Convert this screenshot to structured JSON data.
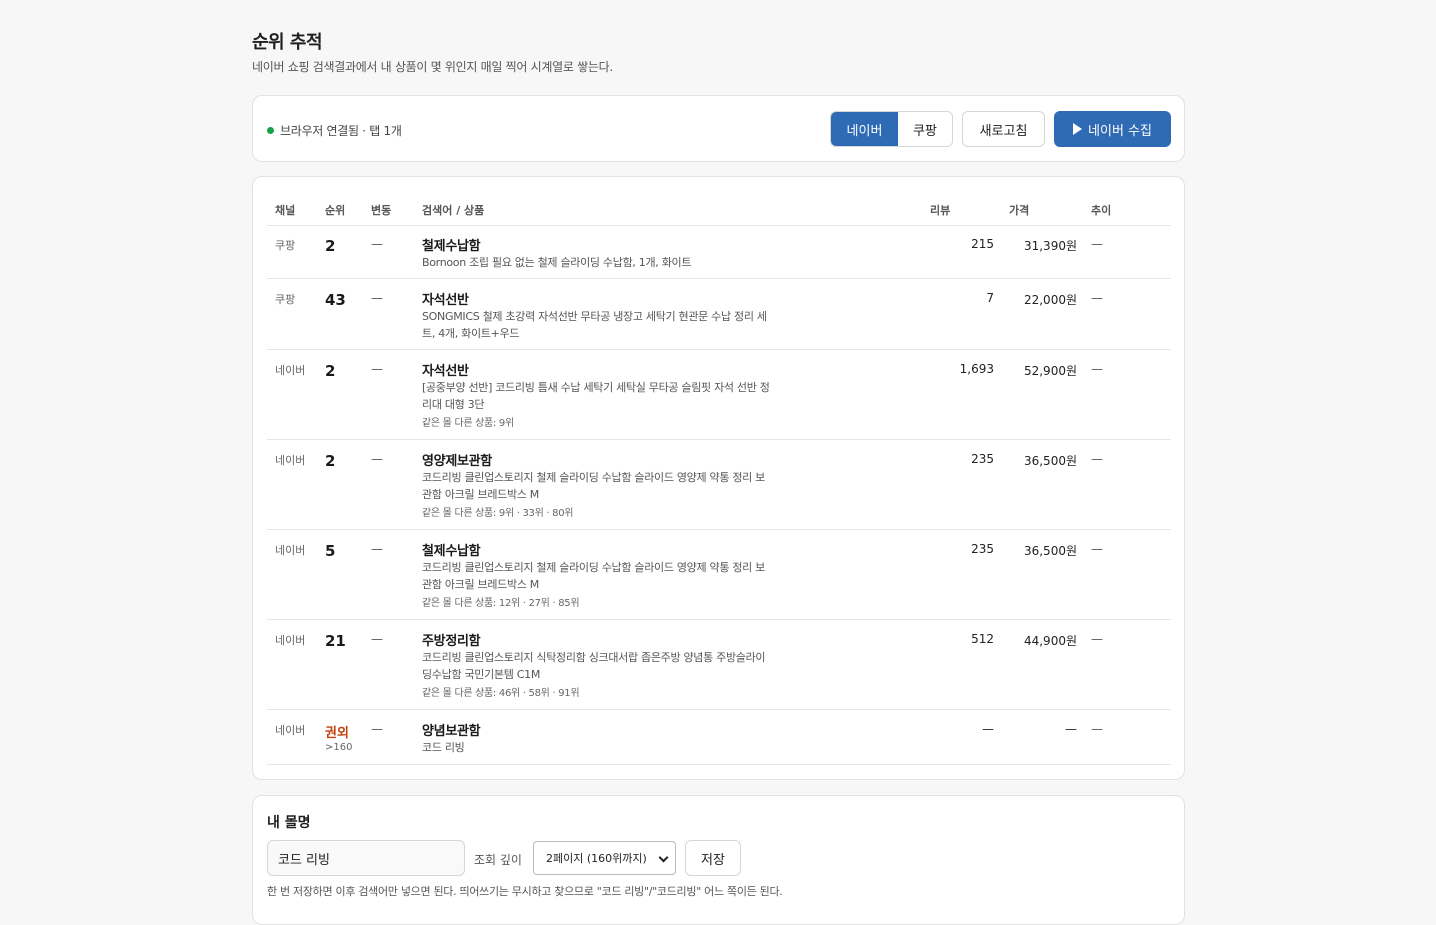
{
  "header": {
    "title": "순위 추적",
    "description": "네이버 쇼핑 검색결과에서 내 상품이 몇 위인지 매일 찍어 시계열로 쌓는다."
  },
  "toolbar": {
    "status": "브라우저 연결됨 · 탭 1개",
    "status_color": "#16a34a",
    "channels": [
      "네이버",
      "쿠팡"
    ],
    "active_channel": "네이버",
    "refresh_label": "새로고침",
    "collect_label": "네이버 수집",
    "accent": "#2f6bb5"
  },
  "table": {
    "headers": {
      "channel": "채널",
      "rank": "순위",
      "change": "변동",
      "keyword": "검색어 / 상품",
      "reviews": "리뷰",
      "price": "가격",
      "trend": "추이"
    },
    "rows": [
      {
        "channel": "쿠팡",
        "rank": "2",
        "change": "—",
        "keyword": "철제수납함",
        "product": "Bornoon 조립 필요 없는 철제 슬라이딩 수납함, 1개, 화이트",
        "same": "",
        "reviews": "215",
        "price": "31,390원",
        "trend": "—"
      },
      {
        "channel": "쿠팡",
        "rank": "43",
        "change": "—",
        "keyword": "자석선반",
        "product": "SONGMICS 철제 초강력 자석선반 무타공 냉장고 세탁기 현관문 수납 정리 세트, 4개, 화이트+우드",
        "same": "",
        "reviews": "7",
        "price": "22,000원",
        "trend": "—"
      },
      {
        "channel": "네이버",
        "rank": "2",
        "change": "—",
        "keyword": "자석선반",
        "product": "[공중부양 선반] 코드리빙 틈새 수납 세탁기 세탁실 무타공 슬림핏 자석 선반 정리대 대형 3단",
        "same": "같은 몰 다른 상품: 9위",
        "reviews": "1,693",
        "price": "52,900원",
        "trend": "—"
      },
      {
        "channel": "네이버",
        "rank": "2",
        "change": "—",
        "keyword": "영양제보관함",
        "product": "코드리빙 클린업스토리지 철제 슬라이딩 수납함 슬라이드 영양제 약통 정리 보관함 아크릴 브레드박스 M",
        "same": "같은 몰 다른 상품: 9위 · 33위 · 80위",
        "reviews": "235",
        "price": "36,500원",
        "trend": "—"
      },
      {
        "channel": "네이버",
        "rank": "5",
        "change": "—",
        "keyword": "철제수납함",
        "product": "코드리빙 클린업스토리지 철제 슬라이딩 수납함 슬라이드 영양제 약통 정리 보관함 아크릴 브레드박스 M",
        "same": "같은 몰 다른 상품: 12위 · 27위 · 85위",
        "reviews": "235",
        "price": "36,500원",
        "trend": "—"
      },
      {
        "channel": "네이버",
        "rank": "21",
        "change": "—",
        "keyword": "주방정리함",
        "product": "코드리빙 클린업스토리지 식탁정리함 싱크대서랍 좁은주방 양념통 주방슬라이딩수납함 국민기본템 C1M",
        "same": "같은 몰 다른 상품: 46위 · 58위 · 91위",
        "reviews": "512",
        "price": "44,900원",
        "trend": "—"
      },
      {
        "channel": "네이버",
        "rank": "권외",
        "rank_sub": ">160",
        "change": "—",
        "keyword": "양념보관함",
        "product": "코드 리빙",
        "same": "",
        "reviews": "—",
        "price": "—",
        "trend": "—"
      }
    ]
  },
  "shop": {
    "title": "내 몰명",
    "name_value": "코드 리빙",
    "depth_label": "조회 깊이",
    "depth_value": "2페이지 (160위까지)",
    "save_label": "저장",
    "note": "한 번 저장하면 이후 검색어만 넣으면 된다. 띄어쓰기는 무시하고 찾으므로 \"코드 리빙\"/\"코드리빙\" 어느 쪽이든 된다."
  }
}
